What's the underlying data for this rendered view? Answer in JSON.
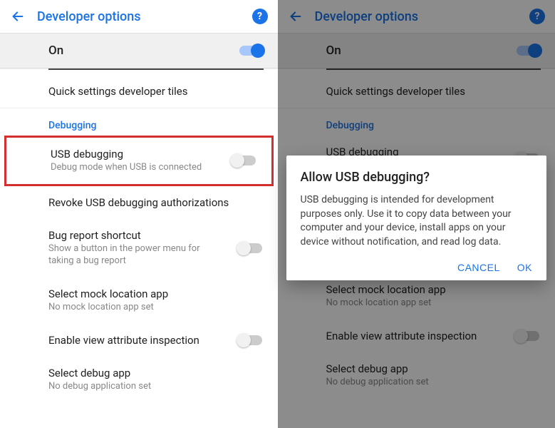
{
  "header": {
    "title": "Developer options"
  },
  "on_row": {
    "label": "On",
    "enabled": true
  },
  "section_debugging": "Debugging",
  "items": {
    "quick_tiles": {
      "primary": "Quick settings developer tiles"
    },
    "usb_debugging": {
      "primary": "USB debugging",
      "secondary": "Debug mode when USB is connected",
      "enabled": false
    },
    "revoke": {
      "primary": "Revoke USB debugging authorizations"
    },
    "bug_shortcut": {
      "primary": "Bug report shortcut",
      "secondary": "Show a button in the power menu for taking a bug report",
      "enabled": false
    },
    "mock_location": {
      "primary": "Select mock location app",
      "secondary": "No mock location app set"
    },
    "view_attr": {
      "primary": "Enable view attribute inspection",
      "enabled": false
    },
    "debug_app": {
      "primary": "Select debug app",
      "secondary": "No debug application set"
    }
  },
  "dialog": {
    "title": "Allow USB debugging?",
    "body": "USB debugging is intended for development purposes only. Use it to copy data between your computer and your device, install apps on your device without notification, and read log data.",
    "cancel": "CANCEL",
    "ok": "OK"
  }
}
